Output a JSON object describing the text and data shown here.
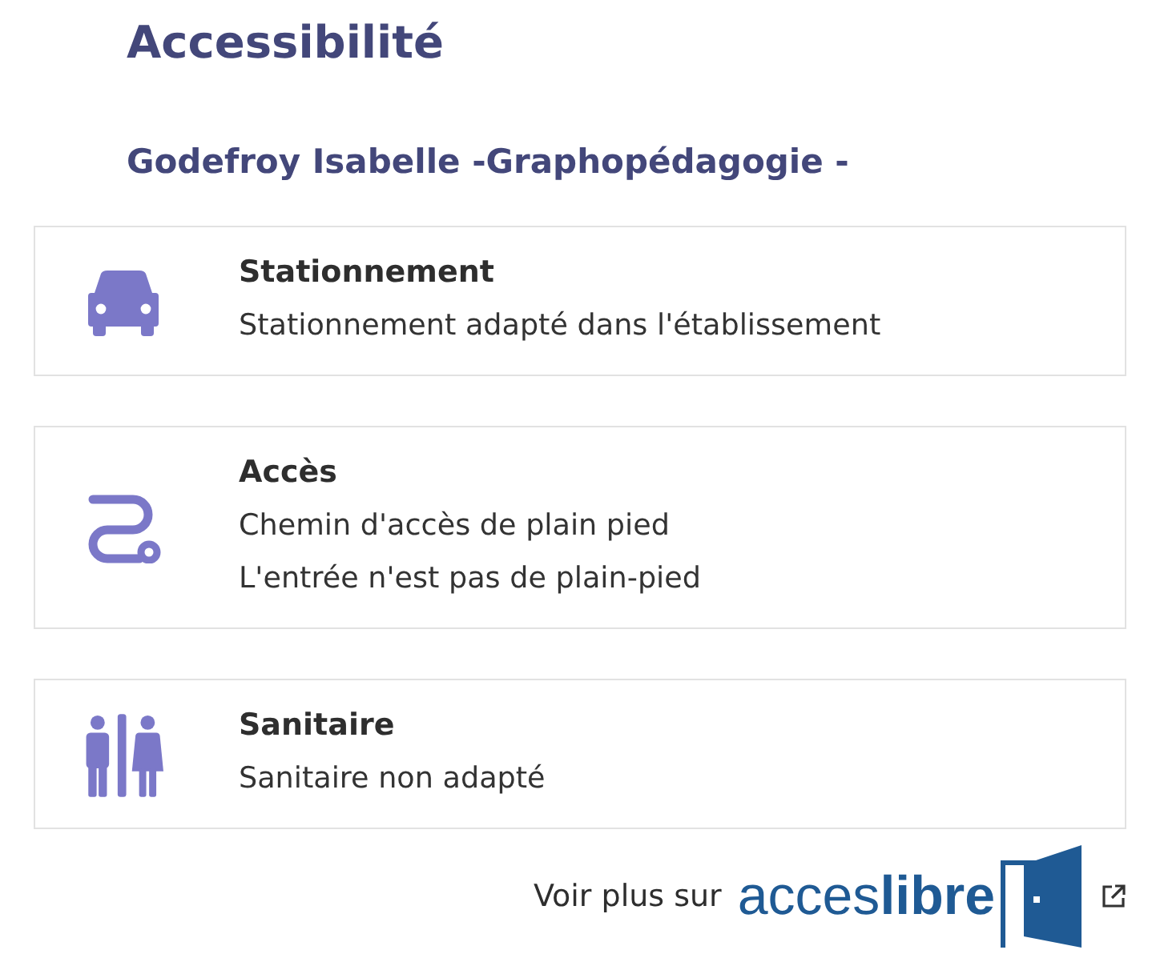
{
  "heading": "Accessibilité",
  "establishment": "Godefroy Isabelle -Graphopédagogie -",
  "sections": [
    {
      "kind": "parking",
      "title": "Stationnement",
      "lines": [
        "Stationnement adapté dans l'établissement"
      ]
    },
    {
      "kind": "path",
      "title": "Accès",
      "lines": [
        "Chemin d'accès de plain pied",
        "L'entrée n'est pas de plain-pied"
      ]
    },
    {
      "kind": "toilets",
      "title": "Sanitaire",
      "lines": [
        "Sanitaire non adapté"
      ]
    }
  ],
  "footer": {
    "label": "Voir plus sur",
    "logo": "acces**libre**"
  }
}
